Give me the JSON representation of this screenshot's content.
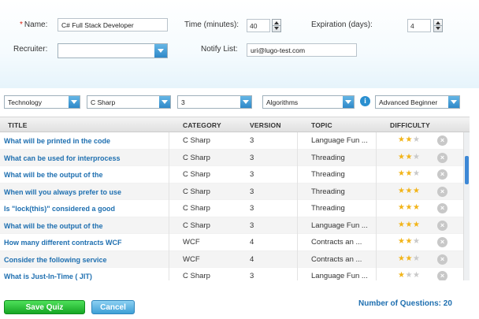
{
  "form": {
    "name_label": "Name:",
    "name_required_mark": "*",
    "name_value": "C# Full Stack Developer",
    "time_label": "Time (minutes):",
    "time_value": "40",
    "expiration_label": "Expiration (days):",
    "expiration_value": "4",
    "recruiter_label": "Recruiter:",
    "recruiter_value": "",
    "notify_label": "Notify List:",
    "notify_value": "uri@lugo-test.com"
  },
  "filters": {
    "technology": "Technology",
    "language": "C Sharp",
    "version": "3",
    "topic": "Algorithms",
    "difficulty": "Advanced Beginner",
    "info_icon": "i"
  },
  "grid": {
    "columns": [
      "TITLE",
      "CATEGORY",
      "VERSION",
      "TOPIC",
      "DIFFICULTY"
    ],
    "rows": [
      {
        "title": "What will be printed in the code",
        "category": "C Sharp",
        "version": "3",
        "topic": "Language Fun ...",
        "difficulty": 2
      },
      {
        "title": "What can be used for interprocess",
        "category": "C Sharp",
        "version": "3",
        "topic": "Threading",
        "difficulty": 2
      },
      {
        "title": "What will be the output of the",
        "category": "C Sharp",
        "version": "3",
        "topic": "Threading",
        "difficulty": 2
      },
      {
        "title": "When will you always prefer to use",
        "category": "C Sharp",
        "version": "3",
        "topic": "Threading",
        "difficulty": 3
      },
      {
        "title": "Is \"lock(this)\" considered a good",
        "category": "C Sharp",
        "version": "3",
        "topic": "Threading",
        "difficulty": 3
      },
      {
        "title": "What will be the output of the",
        "category": "C Sharp",
        "version": "3",
        "topic": "Language Fun ...",
        "difficulty": 3
      },
      {
        "title": "How many different contracts WCF",
        "category": "WCF",
        "version": "4",
        "topic": "Contracts an ...",
        "difficulty": 2
      },
      {
        "title": "Consider the following service",
        "category": "WCF",
        "version": "4",
        "topic": "Contracts an ...",
        "difficulty": 2
      },
      {
        "title": "What is Just-In-Time ( JIT)",
        "category": "C Sharp",
        "version": "3",
        "topic": "Language Fun ...",
        "difficulty": 1
      }
    ],
    "max_difficulty": 3
  },
  "footer": {
    "save_label": "Save Quiz",
    "cancel_label": "Cancel",
    "count_label": "Number of Questions: 20"
  },
  "colors": {
    "accent": "#1e6fb0",
    "save": "#1fb52c",
    "cancel": "#56b3e6",
    "star": "#f2b418"
  }
}
